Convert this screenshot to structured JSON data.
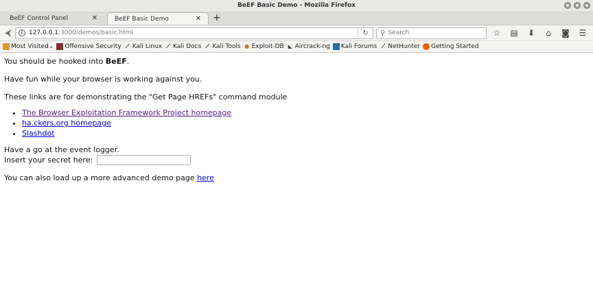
{
  "window": {
    "title": "BeEF Basic Demo - Mozilla Firefox"
  },
  "tabs": [
    {
      "label": "BeEF Control Panel",
      "active": false
    },
    {
      "label": "BeEF Basic Demo",
      "active": true
    }
  ],
  "newtab_symbol": "+",
  "nav": {
    "url_host": "127.0.0.1",
    "url_rest": ":3000/demos/basic.html",
    "search_placeholder": "Search"
  },
  "bookmarks": [
    {
      "label": "Most Visited",
      "icon": "folder-icon"
    },
    {
      "label": "Offensive Security",
      "icon": "offsec-icon"
    },
    {
      "label": "Kali Linux",
      "icon": "kali-dragon-icon"
    },
    {
      "label": "Kali Docs",
      "icon": "kali-dragon-icon"
    },
    {
      "label": "Kali Tools",
      "icon": "kali-dragon-icon"
    },
    {
      "label": "Exploit-DB",
      "icon": "exploit-db-icon"
    },
    {
      "label": "Aircrack-ng",
      "icon": "aircrack-icon"
    },
    {
      "label": "Kali Forums",
      "icon": "kali-forums-icon"
    },
    {
      "label": "NetHunter",
      "icon": "kali-dragon-icon"
    },
    {
      "label": "Getting Started",
      "icon": "firefox-icon"
    }
  ],
  "content": {
    "hooked_prefix": "You should be hooked into ",
    "hooked_bold": "BeEF",
    "hooked_suffix": ".",
    "have_fun": "Have fun while your browser is working against you.",
    "links_intro": "These links are for demonstrating the \"Get Page HREFs\" command module",
    "links": [
      {
        "label": "The Browser Exploitation Framework Project homepage",
        "visited": true
      },
      {
        "label": "ha.ckers.org homepage",
        "visited": false
      },
      {
        "label": "Slashdot",
        "visited": false
      }
    ],
    "event_logger": "Have a go at the event logger.",
    "secret_label": "Insert your secret here:",
    "secret_value": "",
    "advanced_prefix": "You can also load up a more advanced demo page ",
    "advanced_link": "here"
  }
}
